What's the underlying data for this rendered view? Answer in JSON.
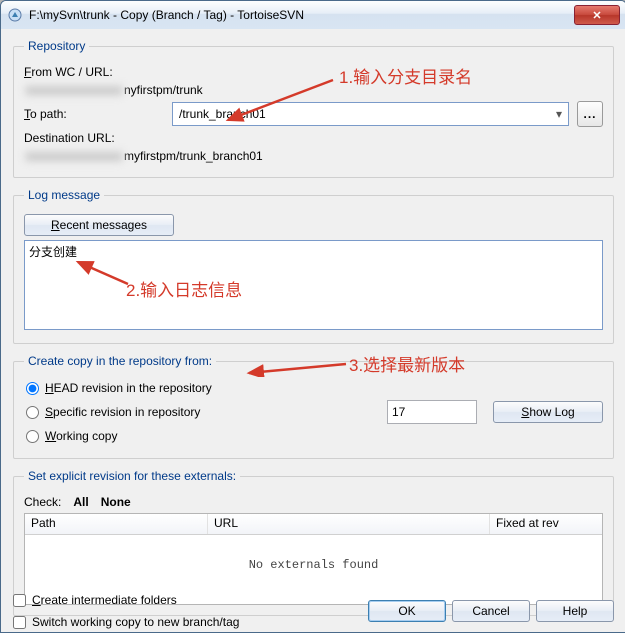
{
  "window": {
    "title": "F:\\mySvn\\trunk - Copy (Branch / Tag) - TortoiseSVN",
    "close_glyph": "✕"
  },
  "repo": {
    "legend": "Repository",
    "from_label_pre": "F",
    "from_label_mid": "rom WC / URL:",
    "from_hidden": "xxxxxxxxxxxxxxxx",
    "from_visible": "nyfirstpm/trunk",
    "to_label_pre": "T",
    "to_label_rest": "o path:",
    "to_value": "/trunk_branch01",
    "browse_glyph": "...",
    "dest_label": "Destination URL:",
    "dest_hidden": "xxxxxxxxxxxxxxxx",
    "dest_visible": "myfirstpm/trunk_branch01"
  },
  "log": {
    "legend": "Log message",
    "recent_pre": "R",
    "recent_rest": "ecent messages",
    "message_value": "分支创建"
  },
  "copyfrom": {
    "legend": "Create copy in the repository from:",
    "head_pre": "H",
    "head_rest": "EAD revision in the repository",
    "spec_pre": "S",
    "spec_rest": "pecific revision in repository",
    "rev_value": "17",
    "showlog_pre": "S",
    "showlog_rest": "how Log",
    "wc_pre": "W",
    "wc_rest": "orking copy"
  },
  "ext": {
    "legend": "Set explicit revision for these externals:",
    "check_label": "Check:",
    "all": "All",
    "none": "None",
    "col_path": "Path",
    "col_url": "URL",
    "col_fixed": "Fixed at rev",
    "empty": "No externals found"
  },
  "footer": {
    "cb1_pre": "C",
    "cb1_rest": "reate intermediate folders",
    "cb2": "Switch working copy to new branch/tag",
    "ok": "OK",
    "cancel": "Cancel",
    "help": "Help"
  },
  "annotations": {
    "a1": "1.输入分支目录名",
    "a2": "2.输入日志信息",
    "a3": "3.选择最新版本"
  }
}
